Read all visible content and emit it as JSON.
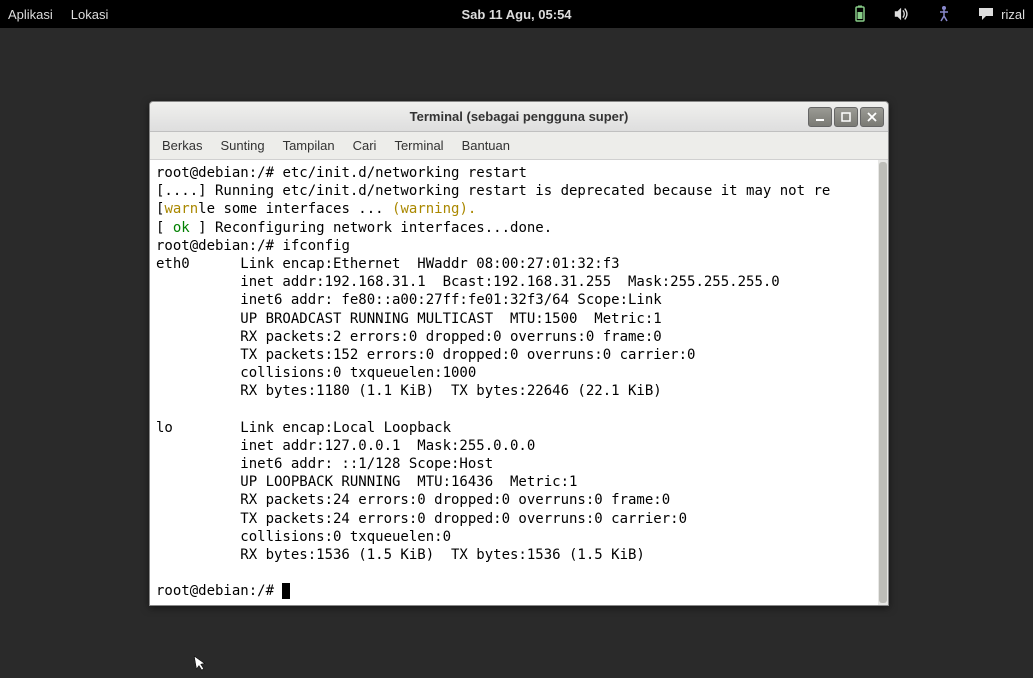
{
  "topbar": {
    "left": [
      "Aplikasi",
      "Lokasi"
    ],
    "center": "Sab 11 Agu, 05:54",
    "username": "rizal"
  },
  "window": {
    "title": "Terminal (sebagai pengguna super)"
  },
  "menu": {
    "items": [
      "Berkas",
      "Sunting",
      "Tampilan",
      "Cari",
      "Terminal",
      "Bantuan"
    ]
  },
  "terminal": {
    "lines": [
      {
        "pre": "root@debian:/# ",
        "text": "etc/init.d/networking restart"
      },
      {
        "text": "[....] Running etc/init.d/networking restart is deprecated because it may not re"
      },
      {
        "segments": [
          {
            "t": "["
          },
          {
            "t": "warn",
            "class": "yellow"
          },
          {
            "t": "le some interfaces ... "
          },
          {
            "t": "(warning).",
            "class": "yellow"
          }
        ]
      },
      {
        "segments": [
          {
            "t": "[ "
          },
          {
            "t": "ok",
            "class": "green"
          },
          {
            "t": " ] Reconfiguring network interfaces...done."
          }
        ]
      },
      {
        "pre": "root@debian:/# ",
        "text": "ifconfig"
      },
      {
        "text": "eth0      Link encap:Ethernet  HWaddr 08:00:27:01:32:f3"
      },
      {
        "text": "          inet addr:192.168.31.1  Bcast:192.168.31.255  Mask:255.255.255.0"
      },
      {
        "text": "          inet6 addr: fe80::a00:27ff:fe01:32f3/64 Scope:Link"
      },
      {
        "text": "          UP BROADCAST RUNNING MULTICAST  MTU:1500  Metric:1"
      },
      {
        "text": "          RX packets:2 errors:0 dropped:0 overruns:0 frame:0"
      },
      {
        "text": "          TX packets:152 errors:0 dropped:0 overruns:0 carrier:0"
      },
      {
        "text": "          collisions:0 txqueuelen:1000"
      },
      {
        "text": "          RX bytes:1180 (1.1 KiB)  TX bytes:22646 (22.1 KiB)"
      },
      {
        "text": ""
      },
      {
        "text": "lo        Link encap:Local Loopback"
      },
      {
        "text": "          inet addr:127.0.0.1  Mask:255.0.0.0"
      },
      {
        "text": "          inet6 addr: ::1/128 Scope:Host"
      },
      {
        "text": "          UP LOOPBACK RUNNING  MTU:16436  Metric:1"
      },
      {
        "text": "          RX packets:24 errors:0 dropped:0 overruns:0 frame:0"
      },
      {
        "text": "          TX packets:24 errors:0 dropped:0 overruns:0 carrier:0"
      },
      {
        "text": "          collisions:0 txqueuelen:0"
      },
      {
        "text": "          RX bytes:1536 (1.5 KiB)  TX bytes:1536 (1.5 KiB)"
      },
      {
        "text": ""
      },
      {
        "pre": "root@debian:/# ",
        "cursor": true
      }
    ]
  }
}
